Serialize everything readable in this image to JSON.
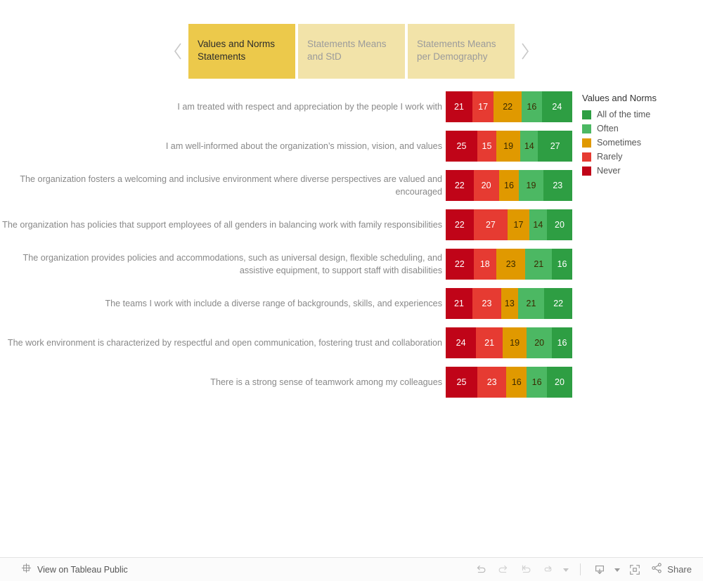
{
  "tabstrip": {
    "prev_label": "‹",
    "next_label": "›",
    "tabs": [
      {
        "label": "Values and Norms Statements",
        "active": true
      },
      {
        "label": "Statements Means and StD",
        "active": false
      },
      {
        "label": "Statements Means per Demography",
        "active": false
      }
    ]
  },
  "legend": {
    "title": "Values and Norms",
    "items": [
      {
        "label": "All of the time",
        "color": "#2E9E43"
      },
      {
        "label": "Often",
        "color": "#4CB863"
      },
      {
        "label": "Sometimes",
        "color": "#E09900"
      },
      {
        "label": "Rarely",
        "color": "#E63B32"
      },
      {
        "label": "Never",
        "color": "#C00418"
      }
    ]
  },
  "chart_data": {
    "type": "bar",
    "subtype": "stacked-horizontal",
    "title": "Values and Norms Statements",
    "xlabel": "",
    "ylabel": "",
    "grid": false,
    "legend_position": "right",
    "legend_title": "Values and Norms",
    "series_order_left_to_right": [
      "Never",
      "Rarely",
      "Sometimes",
      "Often",
      "All of the time"
    ],
    "colors": {
      "All of the time": "#2E9E43",
      "Often": "#4CB863",
      "Sometimes": "#E09900",
      "Rarely": "#E63B32",
      "Never": "#C00418"
    },
    "categories": [
      "I am treated with respect and appreciation by the people I work with",
      "I am well-informed about the organization’s mission, vision, and values",
      "The organization fosters a welcoming and inclusive environment where diverse perspectives are valued and encouraged",
      "The organization has policies that support employees of all genders in balancing work with family responsibilities",
      "The organization provides policies and accommodations, such as universal design, flexible scheduling, and assistive equipment, to support staff with disabilities",
      "The teams I work with include a diverse range of backgrounds, skills, and experiences",
      "The work environment is characterized by respectful and open communication, fostering trust and collaboration",
      "There is a strong sense of teamwork among my colleagues"
    ],
    "series": [
      {
        "name": "Never",
        "color": "#C00418",
        "values": [
          21,
          25,
          22,
          22,
          22,
          21,
          24,
          25
        ]
      },
      {
        "name": "Rarely",
        "color": "#E63B32",
        "values": [
          17,
          15,
          20,
          27,
          18,
          23,
          21,
          23
        ]
      },
      {
        "name": "Sometimes",
        "color": "#E09900",
        "values": [
          22,
          19,
          16,
          17,
          23,
          13,
          19,
          16
        ]
      },
      {
        "name": "Often",
        "color": "#4CB863",
        "values": [
          16,
          14,
          19,
          14,
          21,
          21,
          20,
          16
        ]
      },
      {
        "name": "All of the time",
        "color": "#2E9E43",
        "values": [
          24,
          27,
          23,
          20,
          16,
          22,
          16,
          20
        ]
      }
    ],
    "row_totals": [
      100,
      100,
      100,
      100,
      100,
      100,
      100,
      100
    ]
  },
  "toolbar": {
    "view_on_tableau_public": "View on Tableau Public",
    "share_label": "Share",
    "buttons": [
      {
        "name": "undo",
        "tooltip": "Undo"
      },
      {
        "name": "redo",
        "tooltip": "Redo"
      },
      {
        "name": "revert",
        "tooltip": "Revert"
      },
      {
        "name": "refresh",
        "tooltip": "Refresh"
      },
      {
        "name": "pause-menu",
        "tooltip": "Pause Automatic Updates"
      },
      {
        "name": "download",
        "tooltip": "Download"
      },
      {
        "name": "fullscreen",
        "tooltip": "Full Screen"
      },
      {
        "name": "share",
        "tooltip": "Share"
      }
    ]
  }
}
